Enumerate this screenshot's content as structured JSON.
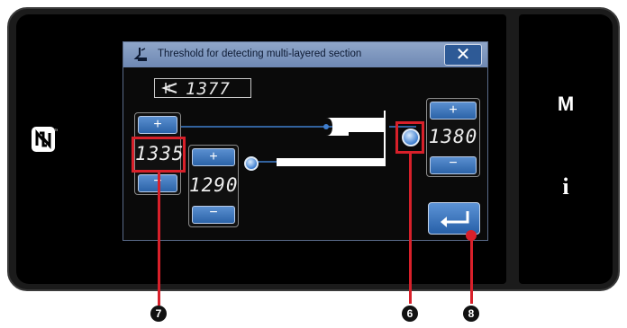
{
  "dialog": {
    "title": "Threshold for detecting multi-layered section",
    "close_label": "✕",
    "current_value": "1377"
  },
  "left_column": {
    "plus_label": "+",
    "value": "1335",
    "minus_label": "−"
  },
  "middle_column": {
    "plus_label": "+",
    "value": "1290",
    "minus_label": "−"
  },
  "right_column": {
    "plus_label": "+",
    "value": "1380",
    "minus_label": "−"
  },
  "side_buttons": {
    "mode": "M",
    "info": "i"
  },
  "callouts": {
    "value_field": "7",
    "knob": "6",
    "enter": "8"
  },
  "colors": {
    "accent_blue": "#2e6bb5",
    "callout_red": "#d8202a",
    "title_bar": "#7f97bf"
  },
  "icons": [
    "nfc-icon",
    "presser-foot-icon",
    "thickness-icon",
    "enter-icon",
    "close-icon"
  ]
}
